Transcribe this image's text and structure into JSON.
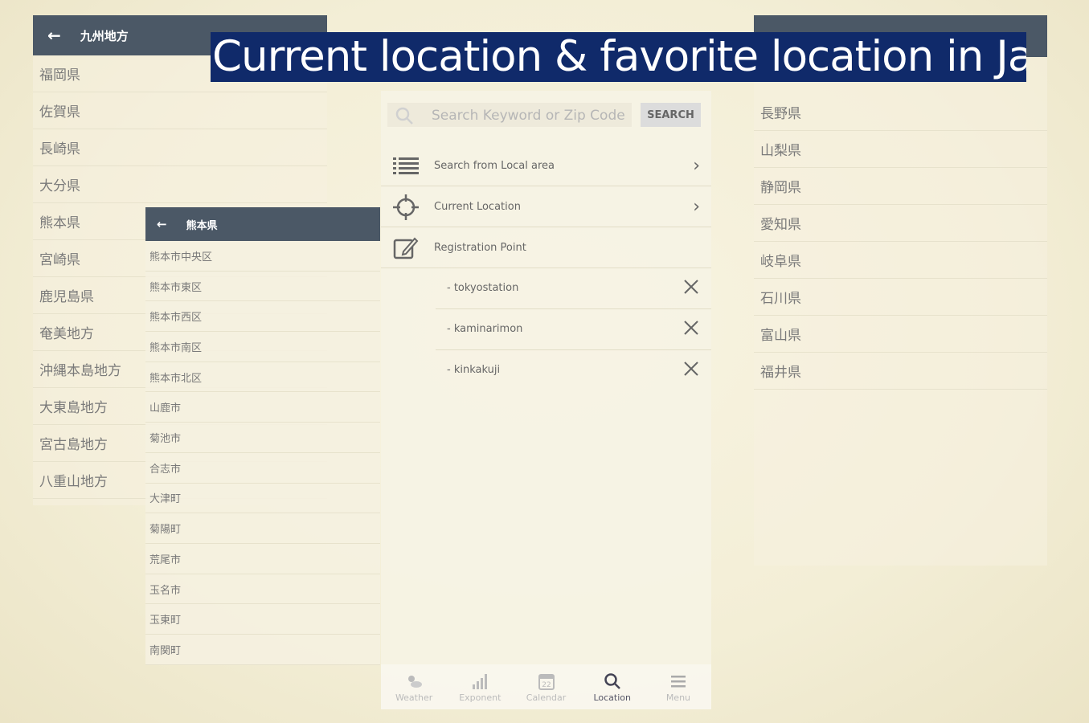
{
  "banner": {
    "text": "Current location & favorite location in Japan"
  },
  "left_panel": {
    "title": "九州地方",
    "items": [
      "福岡県",
      "佐賀県",
      "長崎県",
      "大分県",
      "熊本県",
      "宮崎県",
      "鹿児島県",
      "奄美地方",
      "沖縄本島地方",
      "大東島地方",
      "宮古島地方",
      "八重山地方"
    ]
  },
  "kumamoto_panel": {
    "title": "熊本県",
    "items": [
      "熊本市中央区",
      "熊本市東区",
      "熊本市西区",
      "熊本市南区",
      "熊本市北区",
      "山鹿市",
      "菊池市",
      "合志市",
      "大津町",
      "菊陽町",
      "荒尾市",
      "玉名市",
      "玉東町",
      "南関町"
    ]
  },
  "right_panel": {
    "items": [
      "長野県",
      "山梨県",
      "静岡県",
      "愛知県",
      "岐阜県",
      "石川県",
      "富山県",
      "福井県"
    ]
  },
  "center": {
    "search_placeholder": "Search Keyword or Zip Code",
    "search_button": "SEARCH",
    "menu": [
      {
        "label": "Search from Local area",
        "icon": "list-icon"
      },
      {
        "label": "Current Location",
        "icon": "crosshair-icon"
      },
      {
        "label": "Registration Point",
        "icon": "edit-icon"
      }
    ],
    "favorites": [
      "- tokyostation",
      "- kaminarimon",
      "- kinkakuji"
    ],
    "nav": [
      {
        "label": "Weather",
        "icon": "weather-icon"
      },
      {
        "label": "Exponent",
        "icon": "bar-chart-icon"
      },
      {
        "label": "Calendar",
        "icon": "calendar-icon"
      },
      {
        "label": "Location",
        "icon": "search-icon"
      },
      {
        "label": "Menu",
        "icon": "hamburger-icon"
      }
    ],
    "active_nav": "Location",
    "calendar_day": "22"
  },
  "colors": {
    "appbar": "#4b5866",
    "banner": "#102a6a"
  }
}
